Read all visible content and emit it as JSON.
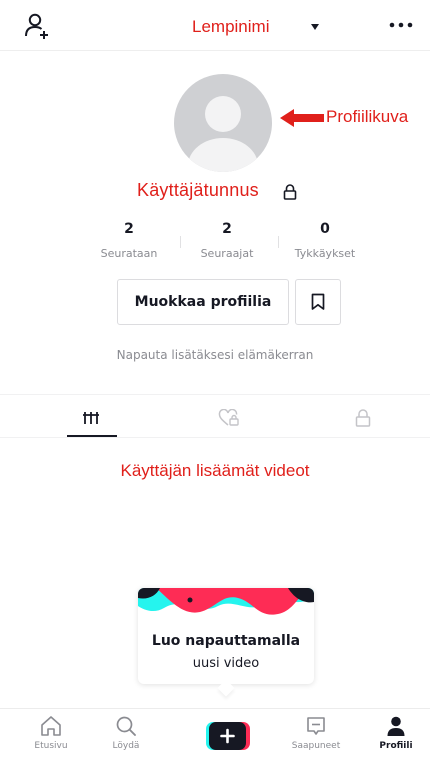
{
  "topbar": {
    "nickname": "Lempinimi"
  },
  "annotations": {
    "profile_picture": "Profiilikuva",
    "username": "Käyttäjätunnus",
    "user_videos": "Käyttäjän lisäämät videot"
  },
  "stats": [
    {
      "value": "2",
      "label": "Seurataan"
    },
    {
      "value": "2",
      "label": "Seuraajat"
    },
    {
      "value": "0",
      "label": "Tykkäykset"
    }
  ],
  "buttons": {
    "edit_profile": "Muokkaa profiilia"
  },
  "bio_hint": "Napauta lisätäksesi elämäkerran",
  "create_card": {
    "line1": "Luo napauttamalla",
    "line2": "uusi video"
  },
  "bottom_nav": [
    {
      "label": "Etusivu",
      "icon": "home-icon"
    },
    {
      "label": "Löydä",
      "icon": "search-icon"
    },
    {
      "label": "",
      "icon": "plus-icon"
    },
    {
      "label": "Saapuneet",
      "icon": "inbox-icon"
    },
    {
      "label": "Profiili",
      "icon": "profile-icon"
    }
  ],
  "colors": {
    "annotation": "#e0201b",
    "tiktok_pink": "#fe2c55",
    "tiktok_cyan": "#25f4ee",
    "text": "#161823",
    "muted": "#8a8b91"
  }
}
